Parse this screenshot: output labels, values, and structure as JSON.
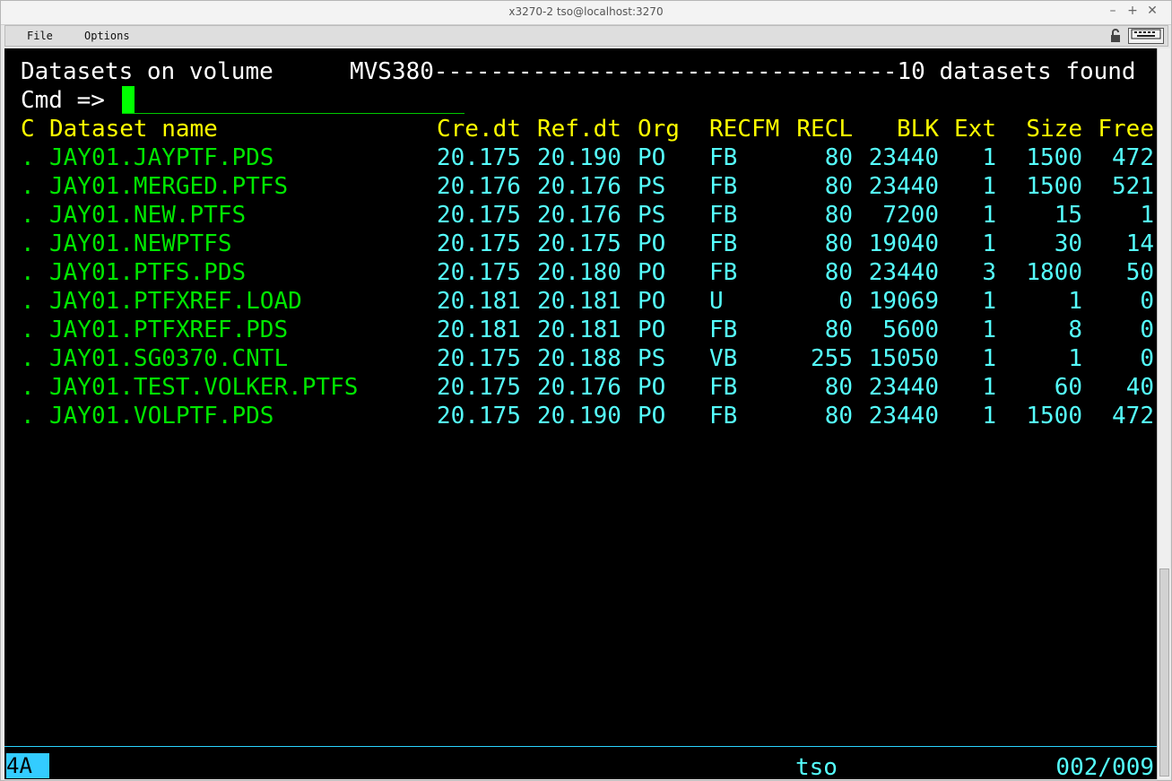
{
  "window": {
    "title": "x3270-2 tso@localhost:3270",
    "controls": [
      "–",
      "+",
      "✕"
    ]
  },
  "menu": {
    "file": "File",
    "options": "Options"
  },
  "screen": {
    "header_left": "Datasets on volume",
    "header_right": "MVS380---------------------------------10 datasets found",
    "cmd_prompt": "Cmd =>",
    "columns": {
      "c": "C",
      "name": "Dataset name",
      "cre": "Cre.dt",
      "ref": "Ref.dt",
      "org": "Org",
      "recfm": "RECFM",
      "recl": "RECL",
      "blk": "BLK",
      "ext": "Ext",
      "size": "Size",
      "free": "Free"
    },
    "rows": [
      {
        "c": ".",
        "name": "JAY01.JAYPTF.PDS",
        "cre": "20.175",
        "ref": "20.190",
        "org": "PO",
        "recfm": "FB",
        "recl": "80",
        "blk": "23440",
        "ext": "1",
        "size": "1500",
        "free": "472"
      },
      {
        "c": ".",
        "name": "JAY01.MERGED.PTFS",
        "cre": "20.176",
        "ref": "20.176",
        "org": "PS",
        "recfm": "FB",
        "recl": "80",
        "blk": "23440",
        "ext": "1",
        "size": "1500",
        "free": "521"
      },
      {
        "c": ".",
        "name": "JAY01.NEW.PTFS",
        "cre": "20.175",
        "ref": "20.176",
        "org": "PS",
        "recfm": "FB",
        "recl": "80",
        "blk": "7200",
        "ext": "1",
        "size": "15",
        "free": "1"
      },
      {
        "c": ".",
        "name": "JAY01.NEWPTFS",
        "cre": "20.175",
        "ref": "20.175",
        "org": "PO",
        "recfm": "FB",
        "recl": "80",
        "blk": "19040",
        "ext": "1",
        "size": "30",
        "free": "14"
      },
      {
        "c": ".",
        "name": "JAY01.PTFS.PDS",
        "cre": "20.175",
        "ref": "20.180",
        "org": "PO",
        "recfm": "FB",
        "recl": "80",
        "blk": "23440",
        "ext": "3",
        "size": "1800",
        "free": "50"
      },
      {
        "c": ".",
        "name": "JAY01.PTFXREF.LOAD",
        "cre": "20.181",
        "ref": "20.181",
        "org": "PO",
        "recfm": "U",
        "recl": "0",
        "blk": "19069",
        "ext": "1",
        "size": "1",
        "free": "0"
      },
      {
        "c": ".",
        "name": "JAY01.PTFXREF.PDS",
        "cre": "20.181",
        "ref": "20.181",
        "org": "PO",
        "recfm": "FB",
        "recl": "80",
        "blk": "5600",
        "ext": "1",
        "size": "8",
        "free": "0"
      },
      {
        "c": ".",
        "name": "JAY01.SG0370.CNTL",
        "cre": "20.175",
        "ref": "20.188",
        "org": "PS",
        "recfm": "VB",
        "recl": "255",
        "blk": "15050",
        "ext": "1",
        "size": "1",
        "free": "0"
      },
      {
        "c": ".",
        "name": "JAY01.TEST.VOLKER.PTFS",
        "cre": "20.175",
        "ref": "20.176",
        "org": "PO",
        "recfm": "FB",
        "recl": "80",
        "blk": "23440",
        "ext": "1",
        "size": "60",
        "free": "40"
      },
      {
        "c": ".",
        "name": "JAY01.VOLPTF.PDS",
        "cre": "20.175",
        "ref": "20.190",
        "org": "PO",
        "recfm": "FB",
        "recl": "80",
        "blk": "23440",
        "ext": "1",
        "size": "1500",
        "free": "472"
      }
    ]
  },
  "oia": {
    "indicator": "4A",
    "lu": "tso",
    "cursor_pos": "002/009"
  },
  "icons": {
    "lock": "lock-icon",
    "keyboard": "keyboard-icon"
  }
}
